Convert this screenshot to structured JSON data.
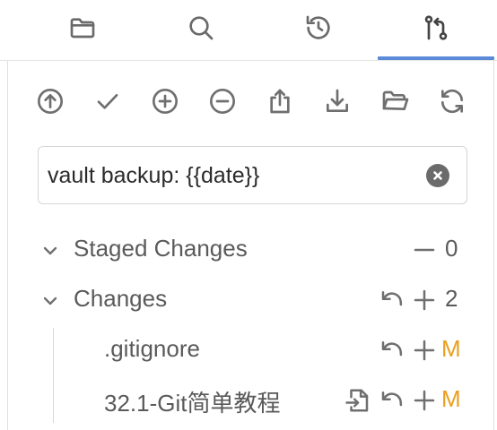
{
  "tabs": [
    {
      "id": "files",
      "icon": "folder-icon"
    },
    {
      "id": "search",
      "icon": "search-icon"
    },
    {
      "id": "history",
      "icon": "history-icon"
    },
    {
      "id": "source-control",
      "icon": "git-pull-request-icon",
      "active": true
    }
  ],
  "toolbar": {
    "actions": [
      {
        "id": "push",
        "icon": "arrow-up-circle-icon"
      },
      {
        "id": "commit",
        "icon": "check-icon"
      },
      {
        "id": "stage-all",
        "icon": "plus-circle-icon"
      },
      {
        "id": "unstage-all",
        "icon": "minus-circle-icon"
      },
      {
        "id": "upload",
        "icon": "upload-icon"
      },
      {
        "id": "pull",
        "icon": "download-icon"
      },
      {
        "id": "open-folder",
        "icon": "folder-open-icon"
      },
      {
        "id": "refresh",
        "icon": "refresh-icon"
      }
    ]
  },
  "commit": {
    "message": "vault backup: {{date}}"
  },
  "staged": {
    "label": "Staged Changes",
    "count": "0"
  },
  "changes": {
    "label": "Changes",
    "count": "2",
    "files": [
      {
        "name": ".gitignore",
        "status": "M"
      },
      {
        "name": "32.1-Git简单教程",
        "status": "M"
      }
    ]
  },
  "colors": {
    "accent": "#5b8bd8",
    "modified": "#e9a020",
    "icon": "#6f6f6f"
  }
}
